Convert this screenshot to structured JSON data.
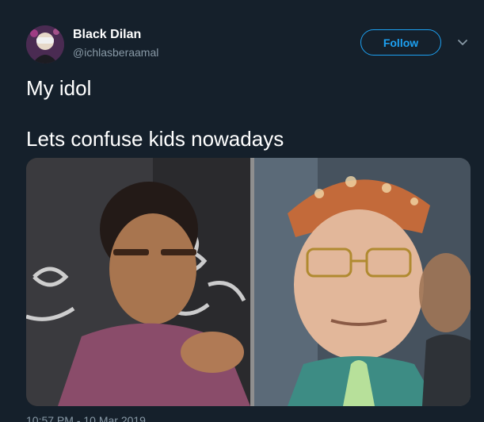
{
  "tweet": {
    "author": {
      "name": "Black Dilan",
      "handle": "@ichlasberaamal",
      "avatar_icon": "avatar-photo"
    },
    "follow_label": "Follow",
    "text": "My idol\n\nLets confuse kids nowadays",
    "media_description_icon": "side-by-side-photo",
    "timestamp": "10:57 PM - 10 Mar 2019"
  },
  "colors": {
    "background": "#15202b",
    "accent": "#1da1f2",
    "muted_text": "#8899a6",
    "text": "#ffffff"
  }
}
